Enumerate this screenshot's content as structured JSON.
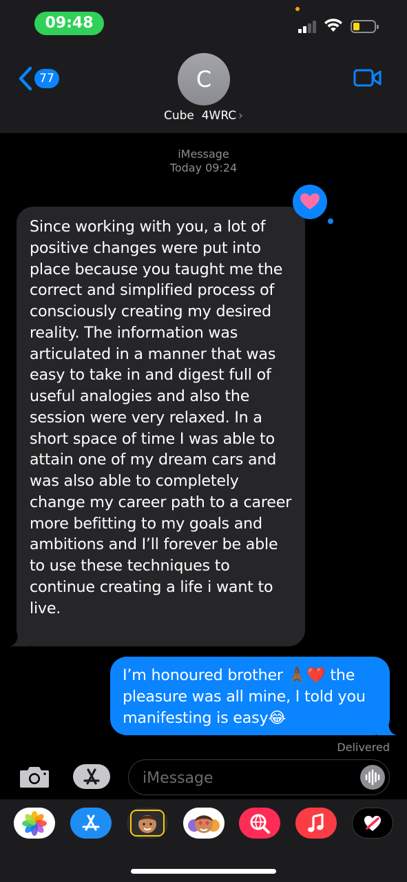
{
  "status_bar": {
    "time": "09:48"
  },
  "header": {
    "back_count": "77",
    "avatar_initial": "C",
    "contact_name": "Cube  4WRC",
    "contact_chevron": "›"
  },
  "conversation": {
    "service": "iMessage",
    "timestamp": "Today 09:24",
    "received_message": "Since working with you, a lot of positive changes were put into place because you taught me the correct and simplified process of consciously creating my desired reality. The information was articulated in a manner that was easy to take in and digest full of useful analogies and also the session were very relaxed. In a short space of time I was able to attain one of my dream cars and was also able to completely change my career path to a career more befitting to my goals and ambitions and I’ll forever be able to use these techniques to continue creating a life i want to live.",
    "received_tapback": "heart-icon",
    "sent_message_part1": "I’m honoured brother ",
    "sent_message_emoji1": "🙏🏾❤️",
    "sent_message_part2": " the pleasure was all mine, I told you manifesting is easy",
    "sent_message_emoji2": "😂",
    "delivery_status": "Delivered"
  },
  "composer": {
    "placeholder": "iMessage"
  },
  "app_strip": [
    {
      "name": "photos-app-icon"
    },
    {
      "name": "app-store-icon"
    },
    {
      "name": "memoji-icon"
    },
    {
      "name": "memoji-stickers-icon"
    },
    {
      "name": "images-search-icon"
    },
    {
      "name": "music-icon"
    },
    {
      "name": "digital-touch-icon"
    }
  ],
  "colors": {
    "accent_blue": "#0a84ff",
    "time_pill_green": "#30d158",
    "received_bubble": "#262629",
    "header_bg": "#1c1c1e"
  }
}
